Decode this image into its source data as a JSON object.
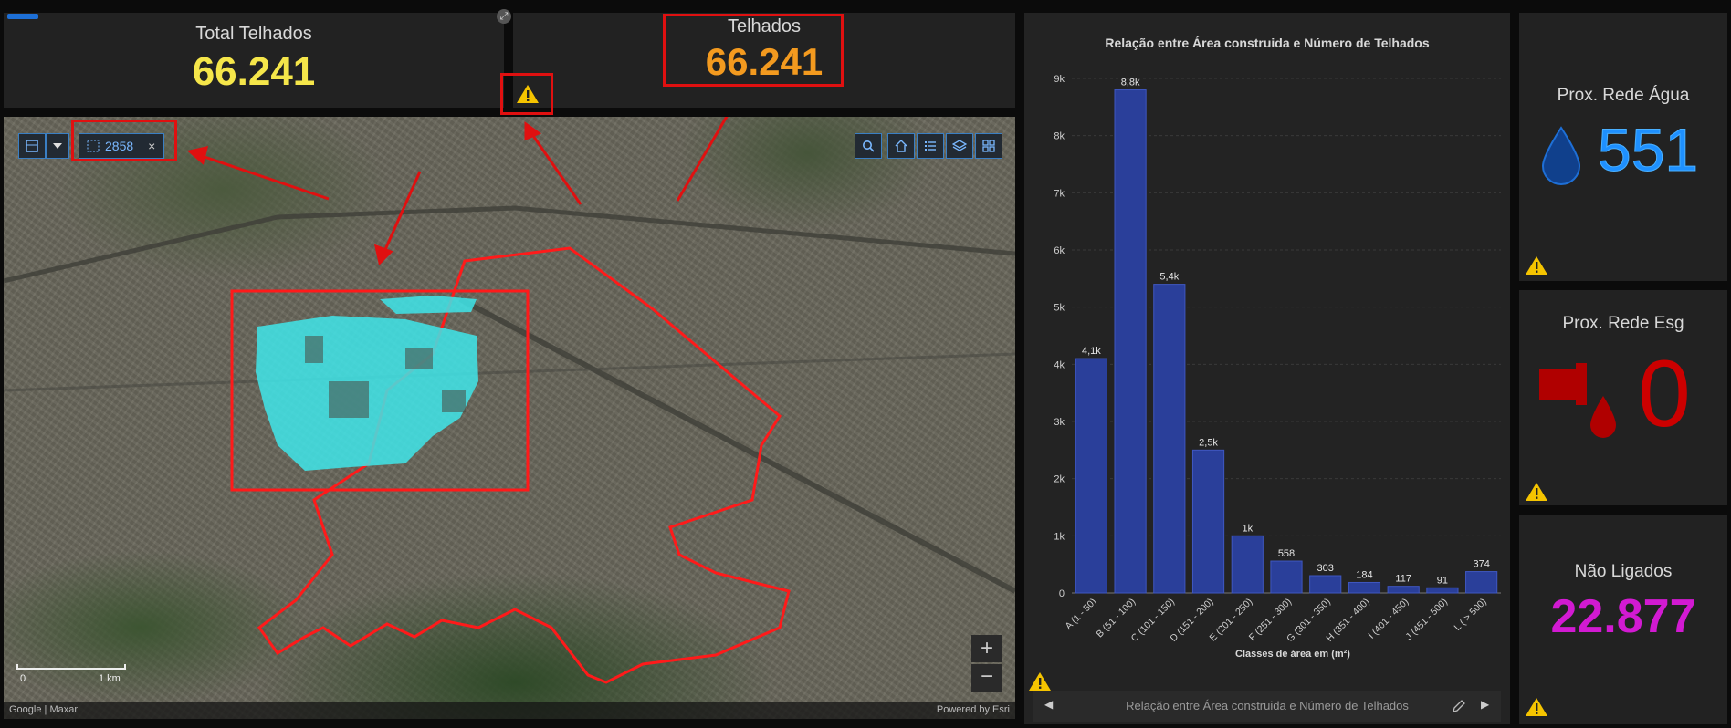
{
  "kpis": {
    "total": {
      "title": "Total Telhados",
      "value": "66.241",
      "color": "#f5e64a"
    },
    "telhados": {
      "title": "Telhados",
      "value": "66.241",
      "color": "#f39a1f"
    },
    "agua": {
      "title": "Prox. Rede Água",
      "value": "551",
      "color": "#1e90ff"
    },
    "esgoto": {
      "title": "Prox. Rede Esg",
      "value": "0",
      "color": "#cc0000"
    },
    "nao_ligados": {
      "title": "Não Ligados",
      "value": "22.877",
      "color": "#d21ad2"
    }
  },
  "map": {
    "selection_count": "2858",
    "scale_start": "0",
    "scale_end": "1 km",
    "attribution_left": "Google | Maxar",
    "attribution_right": "Powered by Esri",
    "zoom_in": "+",
    "zoom_out": "−",
    "close": "×"
  },
  "chart_data": {
    "type": "bar",
    "title": "Relação entre Área construida e Número de Telhados",
    "xlabel": "Classes de área em (m²)",
    "ylabel": "",
    "ylim": [
      0,
      9000
    ],
    "yticks": [
      "0",
      "1k",
      "2k",
      "3k",
      "4k",
      "5k",
      "6k",
      "7k",
      "8k",
      "9k"
    ],
    "categories": [
      "A (1 - 50)",
      "B (51 - 100)",
      "C (101 - 150)",
      "D (151 - 200)",
      "E (201 - 250)",
      "F (251 - 300)",
      "G (301 - 350)",
      "H (351 - 400)",
      "I (401 - 450)",
      "J (451 - 500)",
      "L ( > 500)"
    ],
    "values": [
      4100,
      8800,
      5400,
      2500,
      1000,
      558,
      303,
      184,
      117,
      91,
      374
    ],
    "labels": [
      "4,1k",
      "8,8k",
      "5,4k",
      "2,5k",
      "1k",
      "558",
      "303",
      "184",
      "117",
      "91",
      "374"
    ],
    "bar_color": "#2a3f9a"
  },
  "chart_footer": {
    "text": "Relação entre Área construida e Número de Telhados"
  }
}
